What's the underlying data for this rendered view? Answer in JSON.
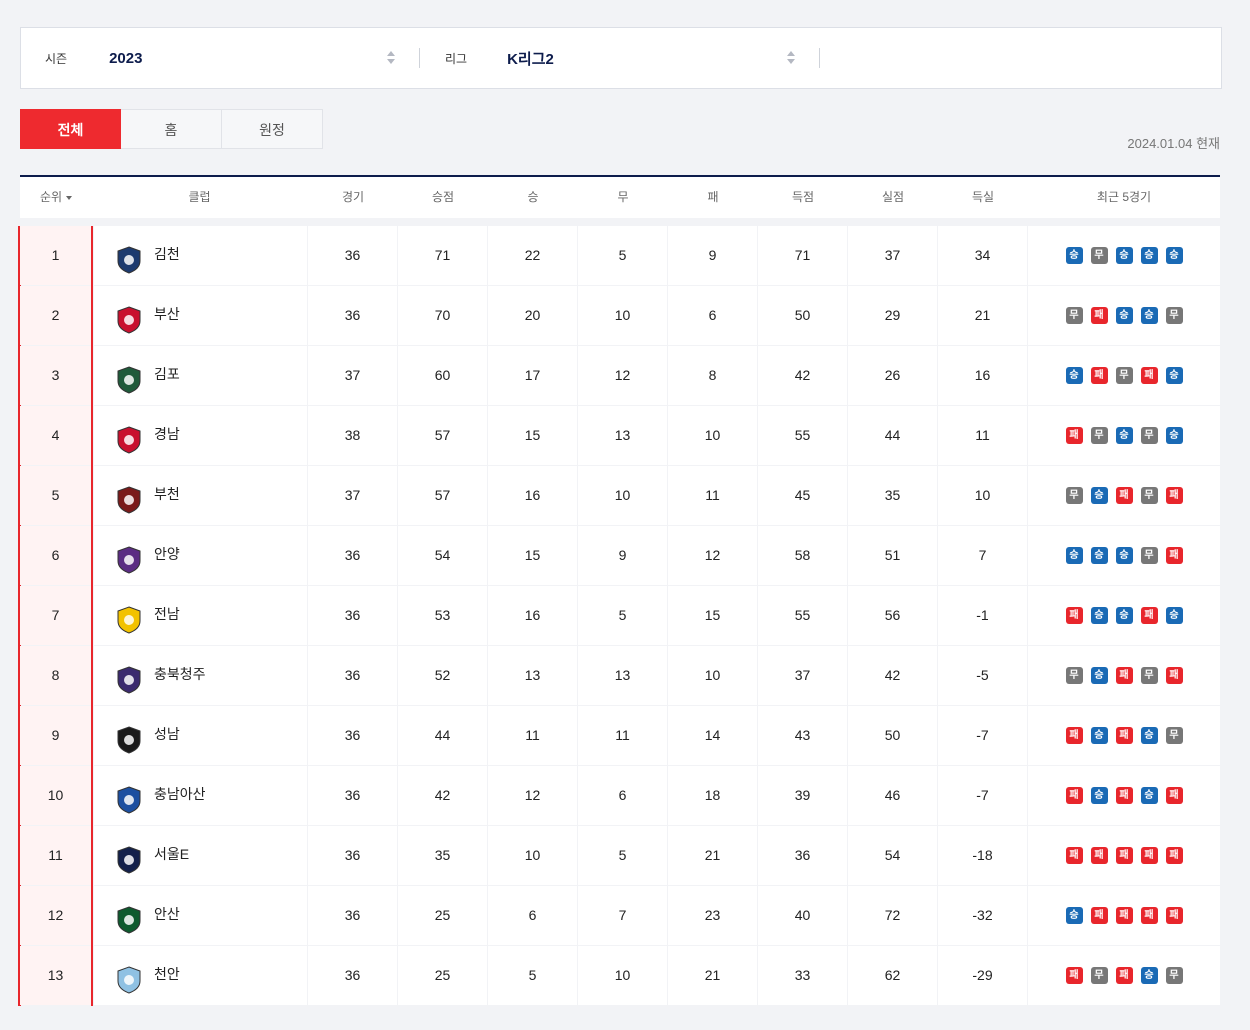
{
  "filters": {
    "season_label": "시즌",
    "season_value": "2023",
    "league_label": "리그",
    "league_value": "K리그2"
  },
  "tabs": [
    {
      "label": "전체",
      "active": true
    },
    {
      "label": "홈",
      "active": false
    },
    {
      "label": "원정",
      "active": false
    }
  ],
  "as_of": "2024.01.04 현재",
  "columns": {
    "rank": "순위",
    "club": "클럽",
    "played": "경기",
    "points": "승점",
    "wins": "승",
    "draws": "무",
    "losses": "패",
    "goals_for": "득점",
    "goals_against": "실점",
    "goal_diff": "득실",
    "recent": "최근 5경기"
  },
  "colors": {
    "win": "#1a6ab5",
    "draw": "#777777",
    "loss": "#e8262c",
    "accent": "#ee2a2f",
    "navy": "#0d1c4c"
  },
  "rows": [
    {
      "rank": "1",
      "club": "김천",
      "logo": "gimcheon-logo",
      "played": "36",
      "points": "71",
      "wins": "22",
      "draws": "5",
      "losses": "9",
      "gf": "71",
      "ga": "37",
      "gd": "34",
      "recent": [
        "승",
        "무",
        "승",
        "승",
        "승"
      ]
    },
    {
      "rank": "2",
      "club": "부산",
      "logo": "busan-logo",
      "played": "36",
      "points": "70",
      "wins": "20",
      "draws": "10",
      "losses": "6",
      "gf": "50",
      "ga": "29",
      "gd": "21",
      "recent": [
        "무",
        "패",
        "승",
        "승",
        "무"
      ]
    },
    {
      "rank": "3",
      "club": "김포",
      "logo": "gimpo-logo",
      "played": "37",
      "points": "60",
      "wins": "17",
      "draws": "12",
      "losses": "8",
      "gf": "42",
      "ga": "26",
      "gd": "16",
      "recent": [
        "승",
        "패",
        "무",
        "패",
        "승"
      ]
    },
    {
      "rank": "4",
      "club": "경남",
      "logo": "gyeongnam-logo",
      "played": "38",
      "points": "57",
      "wins": "15",
      "draws": "13",
      "losses": "10",
      "gf": "55",
      "ga": "44",
      "gd": "11",
      "recent": [
        "패",
        "무",
        "승",
        "무",
        "승"
      ]
    },
    {
      "rank": "5",
      "club": "부천",
      "logo": "bucheon-logo",
      "played": "37",
      "points": "57",
      "wins": "16",
      "draws": "10",
      "losses": "11",
      "gf": "45",
      "ga": "35",
      "gd": "10",
      "recent": [
        "무",
        "승",
        "패",
        "무",
        "패"
      ]
    },
    {
      "rank": "6",
      "club": "안양",
      "logo": "anyang-logo",
      "played": "36",
      "points": "54",
      "wins": "15",
      "draws": "9",
      "losses": "12",
      "gf": "58",
      "ga": "51",
      "gd": "7",
      "recent": [
        "승",
        "승",
        "승",
        "무",
        "패"
      ]
    },
    {
      "rank": "7",
      "club": "전남",
      "logo": "jeonnam-logo",
      "played": "36",
      "points": "53",
      "wins": "16",
      "draws": "5",
      "losses": "15",
      "gf": "55",
      "ga": "56",
      "gd": "-1",
      "recent": [
        "패",
        "승",
        "승",
        "패",
        "승"
      ]
    },
    {
      "rank": "8",
      "club": "충북청주",
      "logo": "chungbuk-logo",
      "played": "36",
      "points": "52",
      "wins": "13",
      "draws": "13",
      "losses": "10",
      "gf": "37",
      "ga": "42",
      "gd": "-5",
      "recent": [
        "무",
        "승",
        "패",
        "무",
        "패"
      ]
    },
    {
      "rank": "9",
      "club": "성남",
      "logo": "seongnam-logo",
      "played": "36",
      "points": "44",
      "wins": "11",
      "draws": "11",
      "losses": "14",
      "gf": "43",
      "ga": "50",
      "gd": "-7",
      "recent": [
        "패",
        "승",
        "패",
        "승",
        "무"
      ]
    },
    {
      "rank": "10",
      "club": "충남아산",
      "logo": "asan-logo",
      "played": "36",
      "points": "42",
      "wins": "12",
      "draws": "6",
      "losses": "18",
      "gf": "39",
      "ga": "46",
      "gd": "-7",
      "recent": [
        "패",
        "승",
        "패",
        "승",
        "패"
      ]
    },
    {
      "rank": "11",
      "club": "서울E",
      "logo": "seoul-e-logo",
      "played": "36",
      "points": "35",
      "wins": "10",
      "draws": "5",
      "losses": "21",
      "gf": "36",
      "ga": "54",
      "gd": "-18",
      "recent": [
        "패",
        "패",
        "패",
        "패",
        "패"
      ]
    },
    {
      "rank": "12",
      "club": "안산",
      "logo": "ansan-logo",
      "played": "36",
      "points": "25",
      "wins": "6",
      "draws": "7",
      "losses": "23",
      "gf": "40",
      "ga": "72",
      "gd": "-32",
      "recent": [
        "승",
        "패",
        "패",
        "패",
        "패"
      ]
    },
    {
      "rank": "13",
      "club": "천안",
      "logo": "cheonan-logo",
      "played": "36",
      "points": "25",
      "wins": "5",
      "draws": "10",
      "losses": "21",
      "gf": "33",
      "ga": "62",
      "gd": "-29",
      "recent": [
        "패",
        "무",
        "패",
        "승",
        "무"
      ]
    }
  ]
}
